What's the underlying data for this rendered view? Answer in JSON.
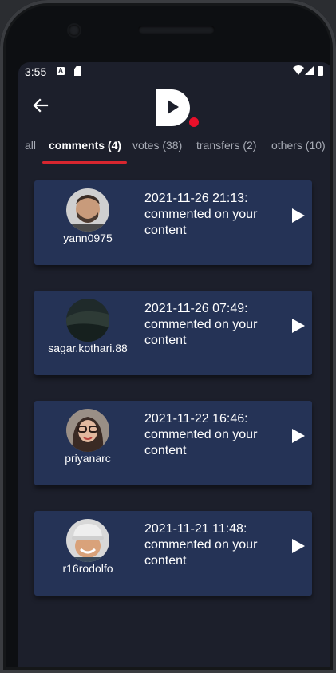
{
  "status_bar": {
    "time": "3:55",
    "icons": [
      "a-notification-icon",
      "sd-card-icon",
      "wifi-icon",
      "signal-icon",
      "battery-icon"
    ]
  },
  "header": {
    "back_icon": "arrow-left-icon",
    "logo": "D."
  },
  "tabs": [
    {
      "label": "all",
      "active": false
    },
    {
      "label": "comments (4)",
      "active": true
    },
    {
      "label": "votes (38)",
      "active": false
    },
    {
      "label": "transfers (2)",
      "active": false
    },
    {
      "label": "others (10)",
      "active": false
    }
  ],
  "notifications": [
    {
      "username": "yann0975",
      "date": "2021-11-26 21:13:",
      "action": "commented on your content"
    },
    {
      "username": "sagar.kothari.88",
      "date": "2021-11-26 07:49:",
      "action": "commented on your content"
    },
    {
      "username": "priyanarc",
      "date": "2021-11-22 16:46:",
      "action": "commented on your content"
    },
    {
      "username": "r16rodolfo",
      "date": "2021-11-21 11:48:",
      "action": "commented on your content"
    }
  ],
  "colors": {
    "background": "#1c1f2b",
    "card": "#253356",
    "accent": "#d7262f",
    "text": "#ffffff",
    "tab_inactive": "#a7abb5"
  }
}
